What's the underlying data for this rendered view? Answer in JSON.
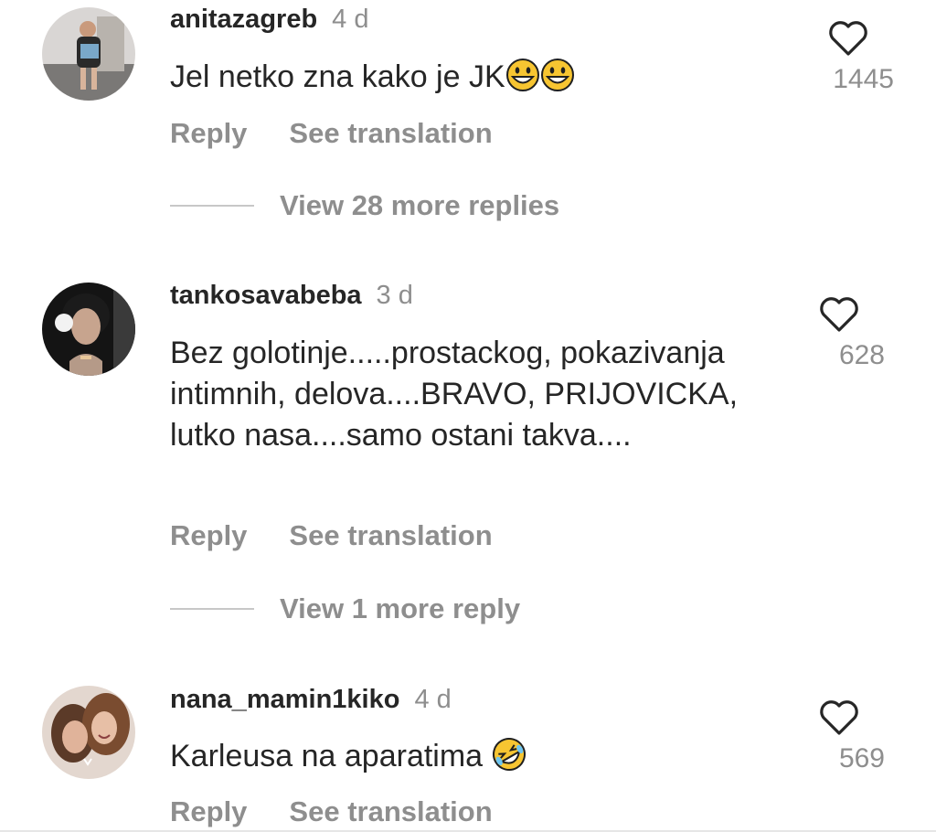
{
  "comments": [
    {
      "username": "anitazagreb",
      "time": "4 d",
      "text": "Jel netko zna kako je JK",
      "emojis": [
        "grinning-face",
        "grinning-face"
      ],
      "likes": "1445",
      "reply_label": "Reply",
      "translate_label": "See translation",
      "view_replies": "View 28 more replies"
    },
    {
      "username": "tankosavabeba",
      "time": "3 d",
      "text": "Bez golotinje.....prostackog, pokazivanja intimnih, delova....BRAVO, PRIJOVICKA, lutko nasa....samo ostani takva....",
      "likes": "628",
      "reply_label": "Reply",
      "translate_label": "See translation",
      "view_replies": "View 1 more reply"
    },
    {
      "username": "nana_mamin1kiko",
      "time": "4 d",
      "text": "Karleusa na aparatima",
      "emojis": [
        "rolling-on-floor-laughing"
      ],
      "likes": "569",
      "reply_label": "Reply",
      "translate_label": "See translation"
    }
  ],
  "colors": {
    "text": "#262626",
    "secondary": "#8e8e8e",
    "divider": "#c7c7c7"
  },
  "icons": {
    "like": "heart-outline-icon"
  }
}
